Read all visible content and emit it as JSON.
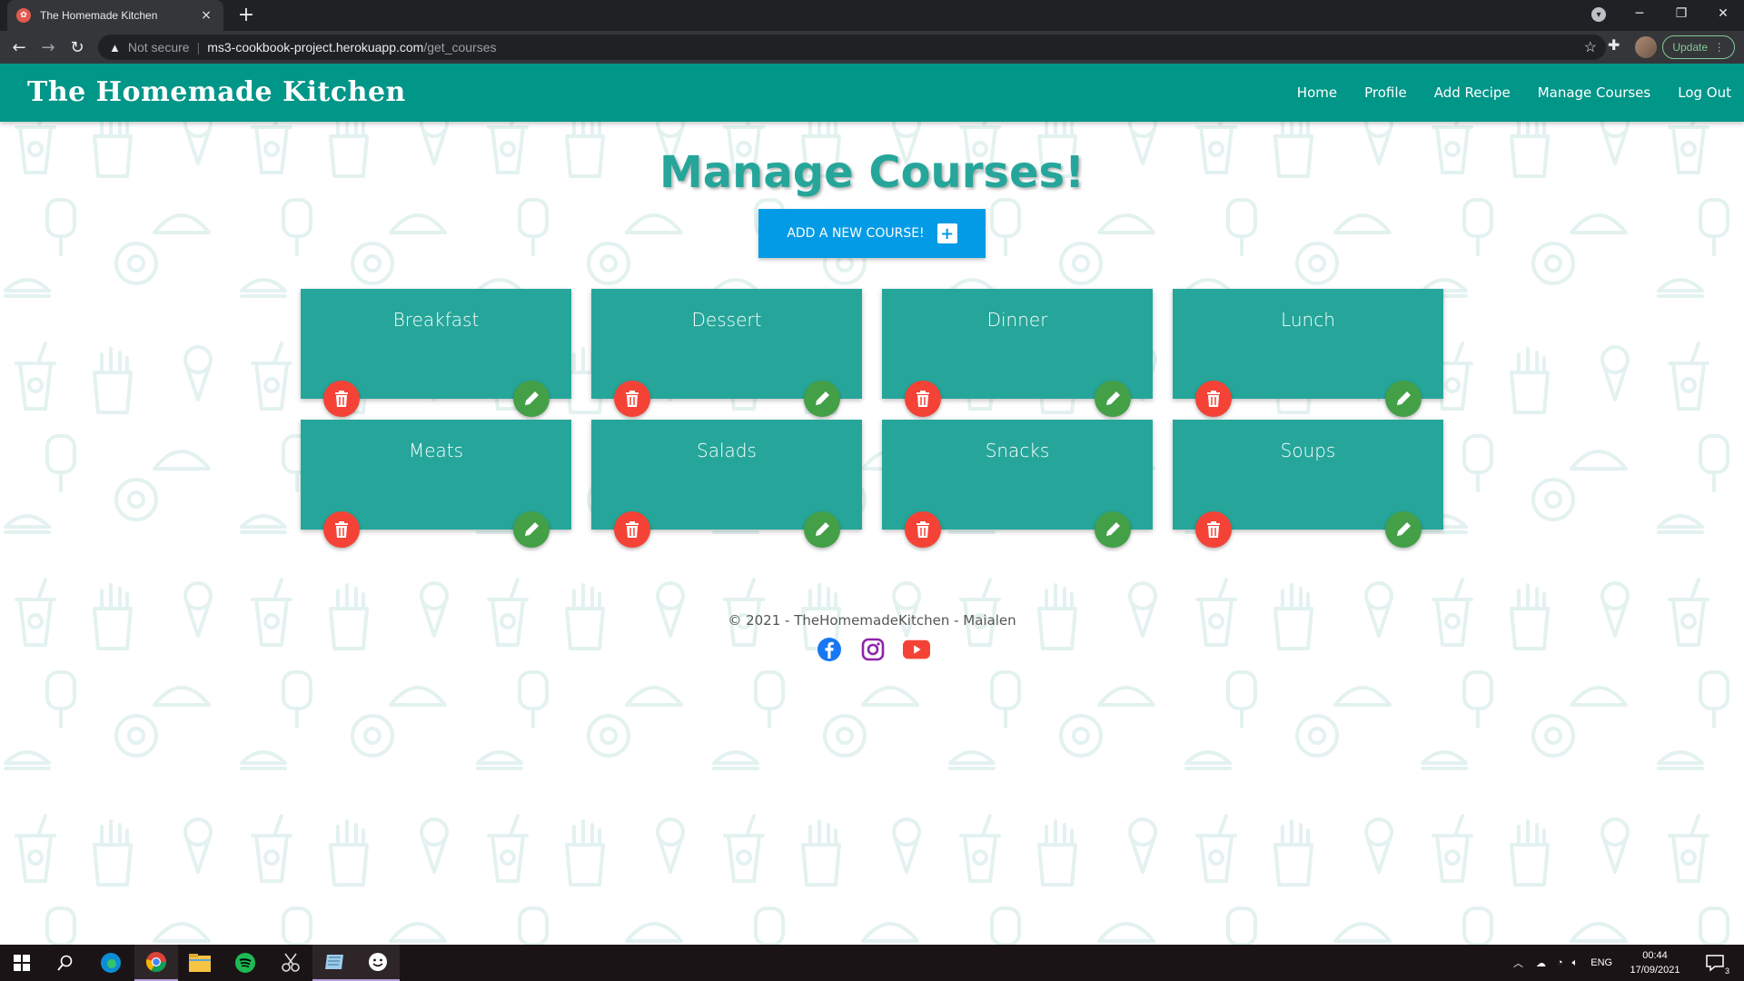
{
  "browser": {
    "tab_title": "The Homemade Kitchen",
    "tab_close": "×",
    "new_tab": "+",
    "security_label": "Not secure",
    "url_host": "ms3-cookbook-project.herokuapp.com",
    "url_path": "/get_courses",
    "update_label": "Update"
  },
  "site": {
    "brand": "The Homemade Kitchen",
    "nav": [
      "Home",
      "Profile",
      "Add Recipe",
      "Manage Courses",
      "Log Out"
    ],
    "heading": "Manage Courses!",
    "add_button": "ADD A NEW COURSE!",
    "courses": [
      "Breakfast",
      "Dessert",
      "Dinner",
      "Lunch",
      "Meats",
      "Salads",
      "Snacks",
      "Soups"
    ],
    "footer": "© 2021 - TheHomemadeKitchen - Maialen"
  },
  "colors": {
    "navbar": "#009688",
    "card": "#26a69a",
    "delete": "#f44336",
    "edit": "#43a047",
    "add_button": "#039be5"
  },
  "taskbar": {
    "lang": "ENG",
    "time": "00:44",
    "date": "17/09/2021",
    "notifications": "3"
  }
}
